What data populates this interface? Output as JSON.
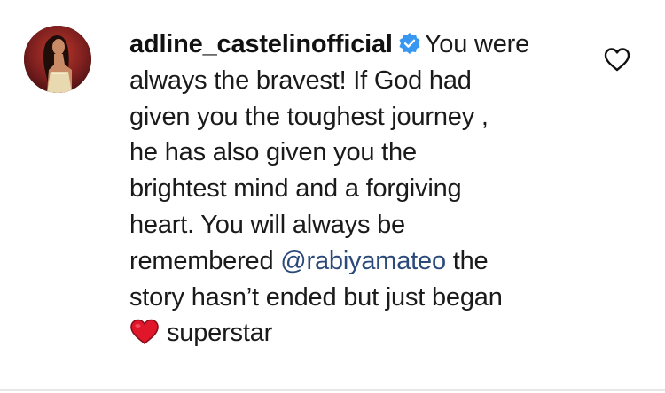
{
  "comment": {
    "username": "adline_castelinofficial",
    "verified": true,
    "lines": [
      "You were",
      "always the bravest! If God had",
      "given you the toughest journey ,",
      "he has also given you the",
      "brightest mind and a forgiving",
      "heart. You will always be"
    ],
    "line7_before": "remembered ",
    "mention": "@rabiyamateo",
    "line7_after": " the",
    "line8": "story hasn’t ended but just began",
    "last_line_emoji": "red-heart",
    "last_line_text": "superstar"
  },
  "icons": {
    "verified_badge": "verified-badge-icon",
    "like": "heart-outline-icon"
  },
  "colors": {
    "text": "#1a1a1a",
    "mention": "#2b4a7a",
    "verified": "#3897f0",
    "emoji_heart": "#e0162b"
  }
}
